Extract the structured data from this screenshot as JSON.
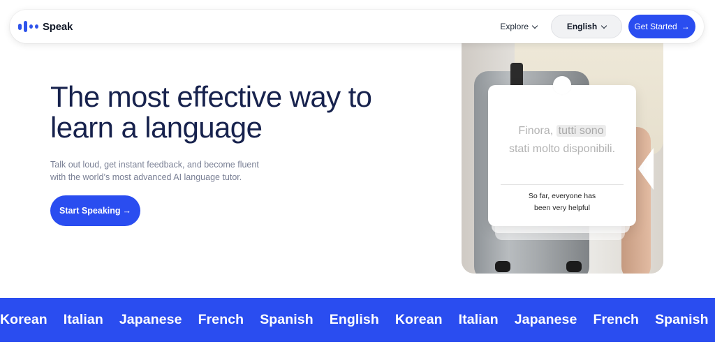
{
  "nav": {
    "brand": "Speak",
    "explore_label": "Explore",
    "language_label": "English",
    "cta_label": "Get Started",
    "cta_arrow": "→"
  },
  "hero": {
    "headline_line1": "The most effective way to",
    "headline_line2": "learn a language",
    "subtext_line1": "Talk out loud, get instant feedback, and become fluent",
    "subtext_line2": "with the world’s most advanced AI language tutor.",
    "button_label": "Start Speaking",
    "button_arrow": "→"
  },
  "card": {
    "it_plain1": "Finora, ",
    "it_highlight": "tutti sono",
    "it_line2": "stati molto disponibili.",
    "en_line1": "So far, everyone has",
    "en_line2": "been very helpful"
  },
  "languages": [
    "Korean",
    "Italian",
    "Japanese",
    "French",
    "Spanish",
    "English",
    "Korean",
    "Italian",
    "Japanese",
    "French",
    "Spanish"
  ],
  "colors": {
    "brand_blue": "#2a4df0",
    "headline_navy": "#17224d"
  },
  "icons": {
    "logo": "speak-wave-logo-icon",
    "explore": "chevron-down-icon",
    "language": "chevron-down-icon",
    "cta": "arrow-right-icon"
  }
}
